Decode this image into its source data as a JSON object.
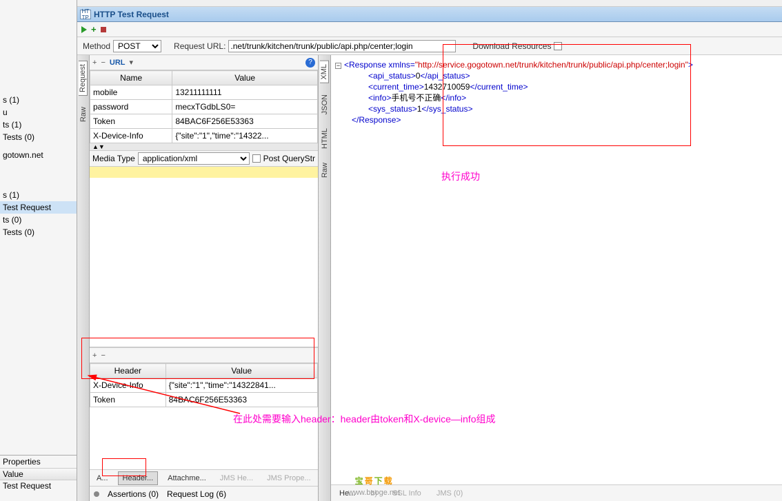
{
  "window": {
    "title": "HTTP Test Request"
  },
  "left": {
    "items": [
      "s (1)",
      "u",
      "ts (1)",
      "Tests (0)",
      "",
      "gotown.net",
      "",
      "s (1)",
      "Test Request",
      "ts (0)",
      "Tests (0)"
    ],
    "selected_index": 8,
    "properties_title": "Properties",
    "prop_cols": [
      "",
      "Value"
    ],
    "prop_name": "Test Request"
  },
  "method_bar": {
    "method_label": "Method",
    "method_value": "POST",
    "url_label": "Request URL:",
    "url_value": ".net/trunk/kitchen/trunk/public/api.php/center;login",
    "download_label": "Download Resources"
  },
  "request": {
    "vt_tabs": [
      "Request",
      "Raw"
    ],
    "cols": [
      "Name",
      "Value"
    ],
    "rows": [
      {
        "name": "mobile",
        "value": "13211111111"
      },
      {
        "name": "password",
        "value": "mecxTGdbLS0="
      },
      {
        "name": "Token",
        "value": "84BAC6F256E53363"
      },
      {
        "name": "X-Device-Info",
        "value": "{\"site\":\"1\",\"time\":\"14322..."
      }
    ],
    "media_label": "Media Type",
    "media_value": "application/xml",
    "post_query_label": "Post QueryStr",
    "header_cols": [
      "Header",
      "Value"
    ],
    "header_rows": [
      {
        "h": "X-Device-Info",
        "v": "{\"site\":\"1\",\"time\":\"14322841..."
      },
      {
        "h": "Token",
        "v": "84BAC6F256E53363"
      }
    ],
    "bottom_tabs": {
      "a": "A...",
      "headers": "Header...",
      "attach": "Attachme...",
      "jmsh": "JMS He...",
      "jmsp": "JMS Prope..."
    },
    "asserts": "Assertions (0)",
    "reqlog": "Request Log (6)"
  },
  "response": {
    "vt_tabs": [
      "XML",
      "JSON",
      "HTML",
      "Raw"
    ],
    "xml": {
      "root_open": "Response",
      "xmlns_attr": "xmlns",
      "xmlns_val": "\"http://service.gogotown.net/trunk/kitchen/trunk/public/api.php/center;login\"",
      "api_status": {
        "tag": "api_status",
        "val": "0"
      },
      "current_time": {
        "tag": "current_time",
        "val": "1432710059"
      },
      "info": {
        "tag": "info",
        "val": "手机号不正确"
      },
      "sys_status": {
        "tag": "sys_status",
        "val": "1"
      }
    },
    "bottom_tabs": {
      "he": "He...",
      "b": "b)",
      "ssl": "SSL Info",
      "jms": "JMS (0)"
    }
  },
  "annotations": {
    "success": "执行成功",
    "header_note": "在此处需要输入header：header由token和X-device—info组成"
  }
}
